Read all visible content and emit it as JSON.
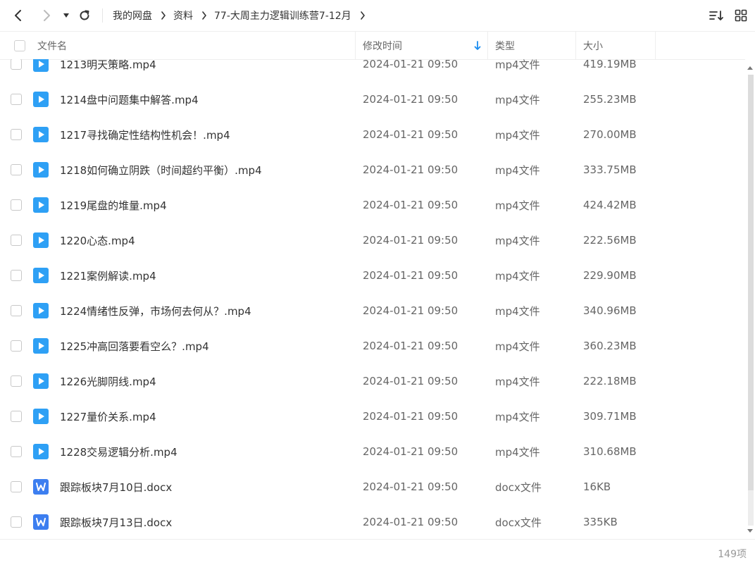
{
  "breadcrumb": [
    {
      "label": "我的网盘"
    },
    {
      "label": "资料"
    },
    {
      "label": "77-大周主力逻辑训练营7-12月"
    }
  ],
  "header": {
    "name": "文件名",
    "time": "修改时间",
    "type": "类型",
    "size": "大小"
  },
  "rows": [
    {
      "name": "1213明天策略.mp4",
      "time": "2024-01-21 09:50",
      "type": "mp4文件",
      "size": "419.19MB",
      "icon": "video-file-icon"
    },
    {
      "name": "1214盘中问题集中解答.mp4",
      "time": "2024-01-21 09:50",
      "type": "mp4文件",
      "size": "255.23MB",
      "icon": "video-file-icon"
    },
    {
      "name": "1217寻找确定性结构性机会！.mp4",
      "time": "2024-01-21 09:50",
      "type": "mp4文件",
      "size": "270.00MB",
      "icon": "video-file-icon"
    },
    {
      "name": "1218如何确立阴跌（时间超约平衡）.mp4",
      "time": "2024-01-21 09:50",
      "type": "mp4文件",
      "size": "333.75MB",
      "icon": "video-file-icon"
    },
    {
      "name": "1219尾盘的堆量.mp4",
      "time": "2024-01-21 09:50",
      "type": "mp4文件",
      "size": "424.42MB",
      "icon": "video-file-icon"
    },
    {
      "name": "1220心态.mp4",
      "time": "2024-01-21 09:50",
      "type": "mp4文件",
      "size": "222.56MB",
      "icon": "video-file-icon"
    },
    {
      "name": "1221案例解读.mp4",
      "time": "2024-01-21 09:50",
      "type": "mp4文件",
      "size": "229.90MB",
      "icon": "video-file-icon"
    },
    {
      "name": "1224情绪性反弹，市场何去何从？.mp4",
      "time": "2024-01-21 09:50",
      "type": "mp4文件",
      "size": "340.96MB",
      "icon": "video-file-icon"
    },
    {
      "name": "1225冲高回落要看空么？.mp4",
      "time": "2024-01-21 09:50",
      "type": "mp4文件",
      "size": "360.23MB",
      "icon": "video-file-icon"
    },
    {
      "name": "1226光脚阴线.mp4",
      "time": "2024-01-21 09:50",
      "type": "mp4文件",
      "size": "222.18MB",
      "icon": "video-file-icon"
    },
    {
      "name": "1227量价关系.mp4",
      "time": "2024-01-21 09:50",
      "type": "mp4文件",
      "size": "309.71MB",
      "icon": "video-file-icon"
    },
    {
      "name": "1228交易逻辑分析.mp4",
      "time": "2024-01-21 09:50",
      "type": "mp4文件",
      "size": "310.68MB",
      "icon": "video-file-icon"
    },
    {
      "name": "跟踪板块7月10日.docx",
      "time": "2024-01-21 09:50",
      "type": "docx文件",
      "size": "16KB",
      "icon": "word-file-icon"
    },
    {
      "name": "跟踪板块7月13日.docx",
      "time": "2024-01-21 09:50",
      "type": "docx文件",
      "size": "335KB",
      "icon": "word-file-icon"
    }
  ],
  "footer": {
    "count": "149项"
  },
  "colors": {
    "accent": "#1a8cf0",
    "video_icon": "#2ea0f5",
    "word_icon": "#3c7ef0"
  }
}
